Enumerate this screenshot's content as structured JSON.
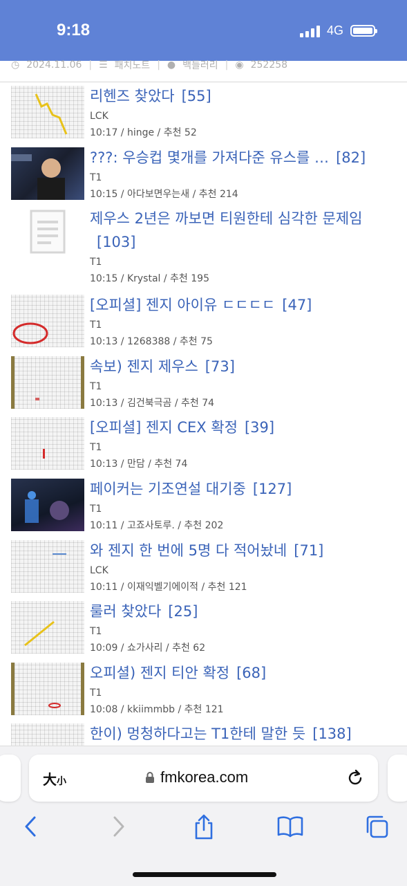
{
  "status": {
    "time": "9:18",
    "network": "4G"
  },
  "meta": {
    "date": "2024.11.06",
    "board": "패치노트",
    "author": "백들러리",
    "views": "252258"
  },
  "posts": [
    {
      "title": "리헨즈 찾았다",
      "count": "[55]",
      "category": "LCK",
      "info": "10:17 / hinge / 추천 52"
    },
    {
      "title": "???: 우승컵 몇개를 가져다준 유스를 …",
      "count": "[82]",
      "category": "T1",
      "info": "10:15 / 아다보면우는새 / 추천 214"
    },
    {
      "title": "제우스 2년은 까보면 티원한테 심각한 문제임",
      "count": "[103]",
      "category": "T1",
      "info": "10:15 / Krystal / 추천 195"
    },
    {
      "title": "[오피셜] 젠지 아이유 ㄷㄷㄷㄷ",
      "count": "[47]",
      "category": "T1",
      "info": "10:13 / 1268388 / 추천 75"
    },
    {
      "title": "속보) 젠지 제우스",
      "count": "[73]",
      "category": "T1",
      "info": "10:13 / 김건북극곰 / 추천 74"
    },
    {
      "title": "[오피셜] 젠지 CEX 확정",
      "count": "[39]",
      "category": "T1",
      "info": "10:13 / 만담 / 추천 74"
    },
    {
      "title": "페이커는 기조연설 대기중",
      "count": "[127]",
      "category": "T1",
      "info": "10:11 / 고죠사토루. / 추천 202"
    },
    {
      "title": "와 젠지 한 번에 5명 다 적어놨네",
      "count": "[71]",
      "category": "LCK",
      "info": "10:11 / 이재익벨기에이적 / 추천 121"
    },
    {
      "title": "룰러 찾았다",
      "count": "[25]",
      "category": "T1",
      "info": "10:09 / 쇼가사리 / 추천 62"
    },
    {
      "title": "오피셜) 젠지 티안 확정",
      "count": "[68]",
      "category": "T1",
      "info": "10:08 / kkiimmbb / 추천 121"
    },
    {
      "title": "한이) 멍청하다고는 T1한테 말한 듯",
      "count": "[138]",
      "category": "",
      "info": ""
    }
  ],
  "browser": {
    "aa_big": "大",
    "aa_small": "小",
    "domain": "fmkorea.com"
  },
  "icons": {
    "back": "chevron-left-icon",
    "forward": "chevron-right-icon",
    "share": "share-icon",
    "bookmarks": "book-icon",
    "tabs": "tabs-icon"
  },
  "colors": {
    "statusbar": "#5f82d6",
    "link": "#3a63b8"
  }
}
